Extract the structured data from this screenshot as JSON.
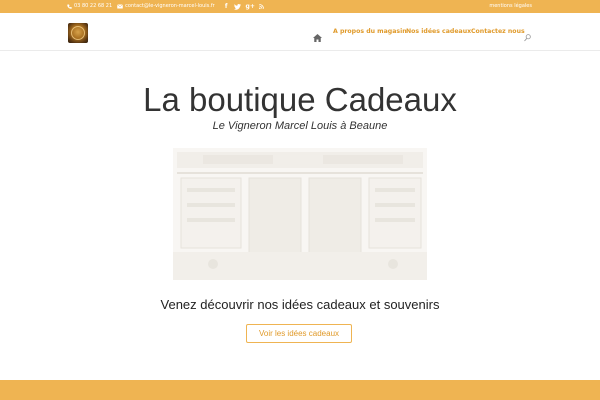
{
  "topbar": {
    "phone": "03 80 22 68 21",
    "email": "contact@le-vigneron-marcel-louis.fr",
    "social": [
      {
        "name": "facebook-icon",
        "glyph": "f"
      },
      {
        "name": "twitter-icon",
        "glyph": "t"
      },
      {
        "name": "google-plus-icon",
        "glyph": "g+"
      },
      {
        "name": "rss-icon",
        "glyph": "rss"
      }
    ],
    "legal_link": "mentions légales",
    "background_color": "#efb452"
  },
  "header": {
    "logo_icon": "vigneron-logo-icon",
    "nav": {
      "home_icon": "home-icon",
      "items": [
        {
          "label": "A propos du magasin"
        },
        {
          "label": "Nos idées cadeaux"
        },
        {
          "label": "Contactez nous"
        }
      ],
      "search_icon": "search-icon"
    },
    "accent_color": "#e09a2a"
  },
  "hero": {
    "title": "La boutique Cadeaux",
    "subtitle": "Le Vigneron Marcel Louis à Beaune",
    "photo_description_icon": "shop-front-photo",
    "tagline": "Venez découvrir nos idées cadeaux et souvenirs",
    "cta_label": "Voir les idées cadeaux"
  },
  "footer": {
    "background_color": "#efb452"
  }
}
